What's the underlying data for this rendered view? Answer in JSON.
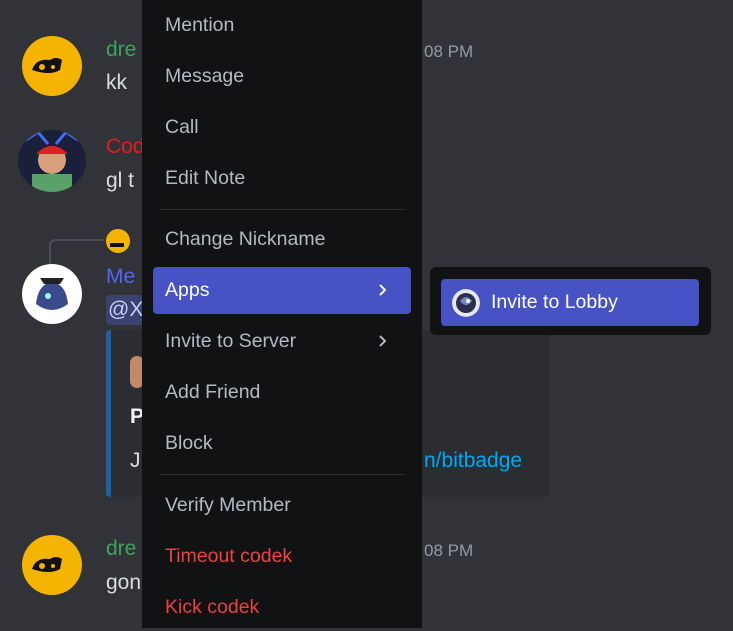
{
  "chat": {
    "messages": [
      {
        "username": "dre",
        "username_color": "#3ba55c",
        "timestamp": "08 PM",
        "text": "kk",
        "avatar_icon": "yellow-blob-avatar-icon"
      },
      {
        "username": "Cod",
        "username_color": "#e01e1e",
        "text": "gl t",
        "avatar_icon": "person-red-cap-avatar-icon"
      },
      {
        "username": "Me",
        "username_color": "#5865f2",
        "mention": "@X",
        "avatar_icon": "blue-creature-avatar-icon"
      },
      {
        "username": "dre",
        "username_color": "#3ba55c",
        "timestamp": "08 PM",
        "text": "gon",
        "avatar_icon": "yellow-blob-avatar-icon"
      }
    ],
    "embed": {
      "title_fragment": "P",
      "desc_fragment": "J",
      "link_fragment": "n/bitbadge"
    }
  },
  "context_menu": {
    "items": [
      {
        "label": "Mention",
        "style": "normal"
      },
      {
        "label": "Message",
        "style": "normal"
      },
      {
        "label": "Call",
        "style": "normal"
      },
      {
        "label": "Edit Note",
        "style": "normal"
      },
      {
        "label": "Change Nickname",
        "style": "normal"
      },
      {
        "label": "Apps",
        "style": "active",
        "submenu": true
      },
      {
        "label": "Invite to Server",
        "style": "normal",
        "submenu": true
      },
      {
        "label": "Add Friend",
        "style": "normal"
      },
      {
        "label": "Block",
        "style": "normal"
      },
      {
        "label": "Verify Member",
        "style": "normal"
      },
      {
        "label": "Timeout codek",
        "style": "danger"
      },
      {
        "label": "Kick codek",
        "style": "danger"
      }
    ]
  },
  "apps_submenu": {
    "items": [
      {
        "label": "Invite to Lobby",
        "icon": "lobby-bot-icon"
      }
    ]
  },
  "colors": {
    "background": "#313338",
    "menu_background": "#111214",
    "highlight": "#4752c4",
    "danger": "#f23f42",
    "menu_text": "#b5bac1"
  }
}
